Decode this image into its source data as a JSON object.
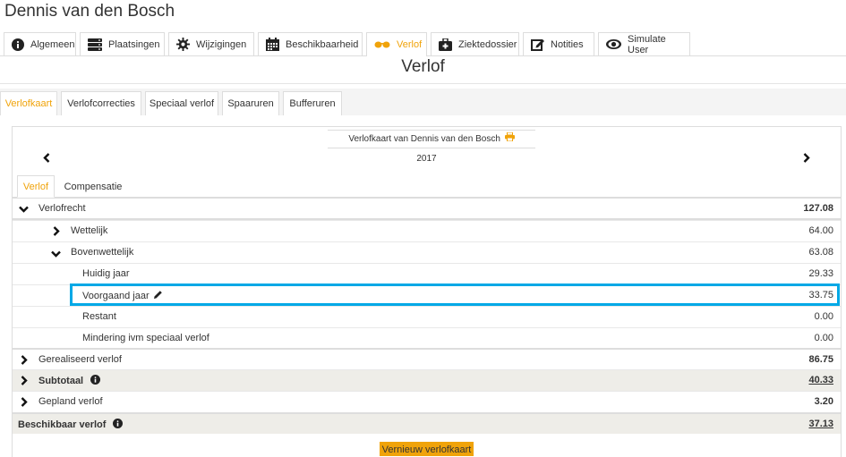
{
  "header": {
    "title": "Dennis van den Bosch"
  },
  "main_tabs": [
    {
      "label": "Algemeen",
      "icon": "info-circle-icon"
    },
    {
      "label": "Plaatsingen",
      "icon": "server-icon"
    },
    {
      "label": "Wijzigingen",
      "icon": "gear-icon"
    },
    {
      "label": "Beschikbaarheid",
      "icon": "calendar-icon"
    },
    {
      "label": "Verlof",
      "icon": "sunglasses-icon",
      "active": true
    },
    {
      "label": "Ziektedossier",
      "icon": "medkit-icon"
    },
    {
      "label": "Notities",
      "icon": "edit-icon"
    },
    {
      "label": "Simulate User",
      "icon": "eye-icon"
    }
  ],
  "page_title": "Verlof",
  "sub_tabs": [
    {
      "label": "Verlofkaart",
      "active": true
    },
    {
      "label": "Verlofcorrecties"
    },
    {
      "label": "Speciaal verlof"
    },
    {
      "label": "Spaaruren"
    },
    {
      "label": "Bufferuren"
    }
  ],
  "card": {
    "title": "Verlofkaart van Dennis van den Bosch",
    "year": "2017"
  },
  "inner_tabs": [
    {
      "label": "Verlof",
      "active": true
    },
    {
      "label": "Compensatie"
    }
  ],
  "rows": {
    "verlofrecht": {
      "label": "Verlofrecht",
      "value": "127.08"
    },
    "wettelijk": {
      "label": "Wettelijk",
      "value": "64.00"
    },
    "bovenwettelijk": {
      "label": "Bovenwettelijk",
      "value": "63.08"
    },
    "huidig_jaar": {
      "label": "Huidig jaar",
      "value": "29.33"
    },
    "voorgaand_jaar": {
      "label": "Voorgaand jaar",
      "value": "33.75"
    },
    "restant": {
      "label": "Restant",
      "value": "0.00"
    },
    "mindering": {
      "label": "Mindering ivm speciaal verlof",
      "value": "0.00"
    },
    "gerealiseerd": {
      "label": "Gerealiseerd verlof",
      "value": "86.75"
    },
    "subtotaal": {
      "label": "Subtotaal",
      "value": "40.33"
    },
    "gepland": {
      "label": "Gepland verlof",
      "value": "3.20"
    },
    "beschikbaar": {
      "label": "Beschikbaar verlof",
      "value": "37.13"
    }
  },
  "button": {
    "label": "Vernieuw verlofkaart"
  },
  "colors": {
    "accent": "#f0a30a",
    "highlight": "#00a8e6",
    "row_gray": "#eeede8"
  }
}
